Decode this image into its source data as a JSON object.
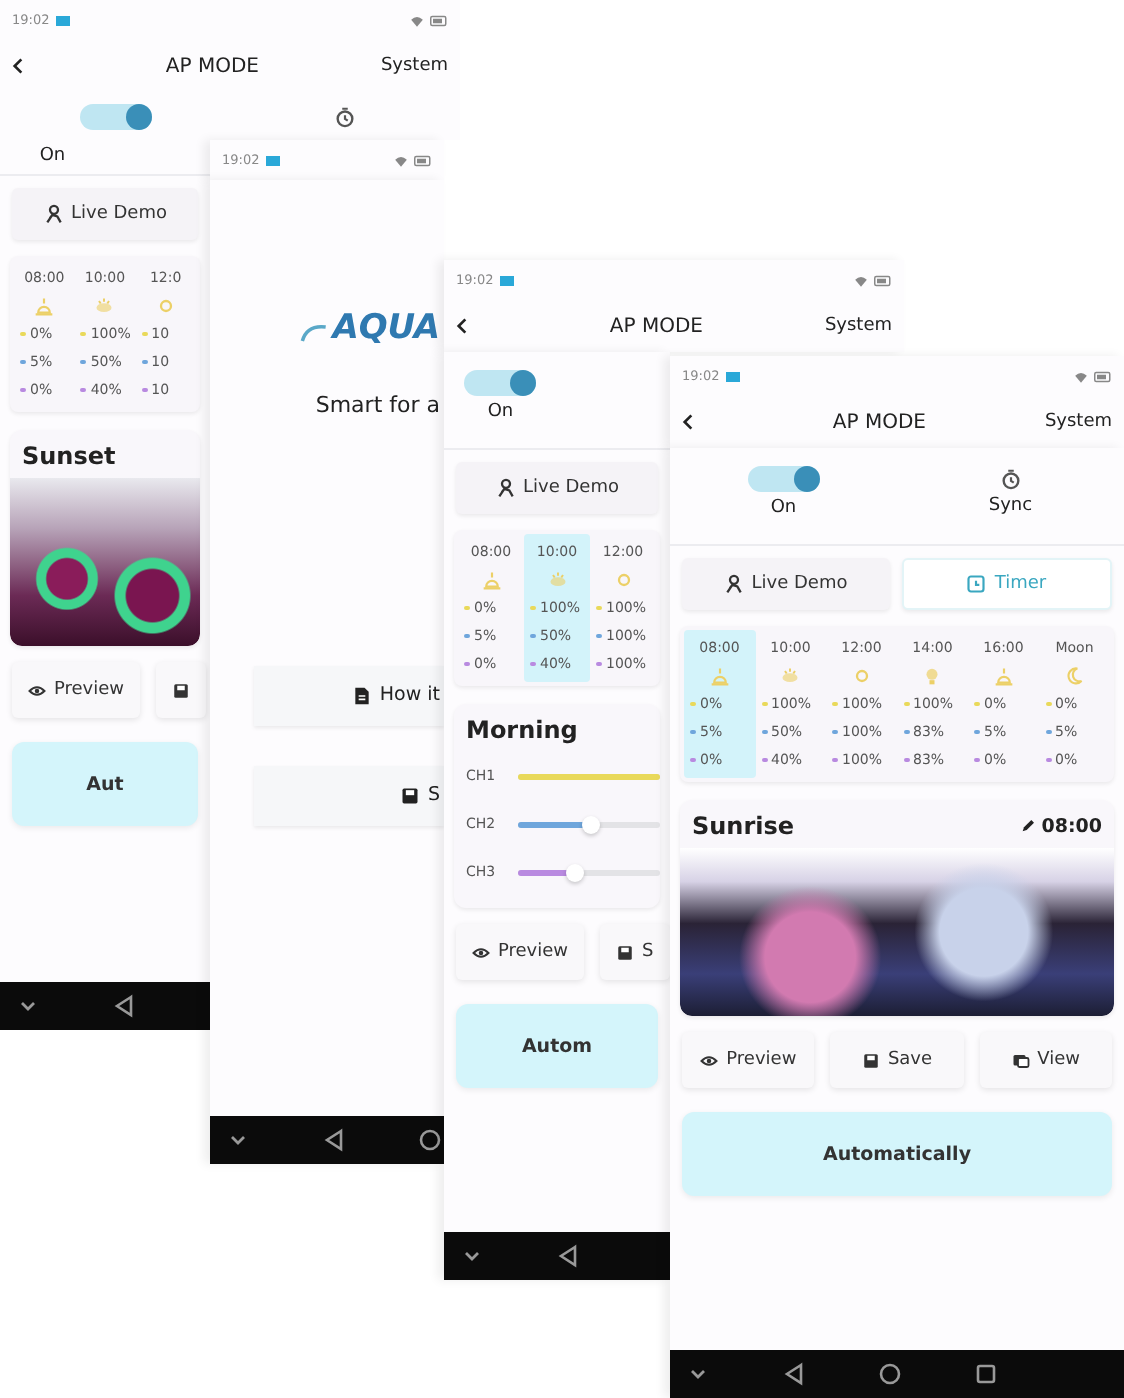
{
  "screens": [
    {
      "status_time": "19:02",
      "header": {
        "title": "AP MODE",
        "action": "System"
      },
      "toggle": {
        "on": true,
        "label": "On"
      },
      "tabs": [
        {
          "label": "Live Demo",
          "kind": "person",
          "selected": false
        }
      ],
      "timeline": {
        "columns": [
          {
            "time": "08:00",
            "kind": "sunrise",
            "selected": false,
            "values": [
              "0%",
              "5%",
              "0%"
            ]
          },
          {
            "time": "10:00",
            "kind": "cloud-sun",
            "selected": false,
            "values": [
              "100%",
              "50%",
              "40%"
            ]
          },
          {
            "time": "12:0",
            "kind": "sun",
            "selected": false,
            "values": [
              "10",
              "10",
              "10"
            ]
          }
        ]
      },
      "scene": {
        "title": "Sunset",
        "kind": "coral"
      },
      "actions": [
        {
          "kind": "eye",
          "label": "Preview"
        },
        {
          "kind": "save"
        }
      ],
      "auto_button": "Aut"
    },
    {
      "status_time": "19:02",
      "logo": "AQUA",
      "tagline": "Smart for a",
      "doc_buttons": [
        {
          "kind": "doc",
          "label": "How it"
        },
        {
          "kind": "save",
          "label": "S"
        }
      ]
    },
    {
      "status_time": "19:02",
      "header": {
        "title": "AP MODE",
        "action": "System"
      },
      "toggle": {
        "on": true,
        "label": "On"
      },
      "tabs": [
        {
          "label": "Live Demo",
          "kind": "person",
          "selected": false
        }
      ],
      "timeline": {
        "columns": [
          {
            "time": "08:00",
            "kind": "sunrise",
            "selected": false,
            "values": [
              "0%",
              "5%",
              "0%"
            ]
          },
          {
            "time": "10:00",
            "kind": "cloud-sun",
            "selected": true,
            "values": [
              "100%",
              "50%",
              "40%"
            ]
          },
          {
            "time": "12:00",
            "kind": "sun",
            "selected": false,
            "values": [
              "100%",
              "100%",
              "100%"
            ]
          }
        ]
      },
      "scene": {
        "title": "Morning",
        "channels": [
          {
            "name": "CH1",
            "level": 1
          },
          {
            "name": "CH2",
            "level": 0.5
          },
          {
            "name": "CH3",
            "level": 0.4
          }
        ]
      },
      "actions": [
        {
          "kind": "eye",
          "label": "Preview"
        },
        {
          "kind": "save",
          "label": "S"
        }
      ],
      "auto_button": "Autom"
    },
    {
      "status_time": "19:02",
      "header": {
        "title": "AP MODE",
        "action": "System"
      },
      "toggle": {
        "on": true,
        "label": "On"
      },
      "sync": {
        "label": "Sync"
      },
      "tabs": [
        {
          "label": "Live Demo",
          "kind": "person",
          "selected": false
        },
        {
          "label": "Timer",
          "kind": "timer",
          "selected": true
        }
      ],
      "timeline": {
        "columns": [
          {
            "time": "08:00",
            "kind": "sunrise",
            "selected": true,
            "values": [
              "0%",
              "5%",
              "0%"
            ]
          },
          {
            "time": "10:00",
            "kind": "cloud-sun",
            "selected": false,
            "values": [
              "100%",
              "50%",
              "40%"
            ]
          },
          {
            "time": "12:00",
            "kind": "sun",
            "selected": false,
            "values": [
              "100%",
              "100%",
              "100%"
            ]
          },
          {
            "time": "14:00",
            "kind": "bulb",
            "selected": false,
            "values": [
              "100%",
              "83%",
              "83%"
            ]
          },
          {
            "time": "16:00",
            "kind": "sunrise",
            "selected": false,
            "values": [
              "0%",
              "5%",
              "0%"
            ]
          },
          {
            "time": "Moon",
            "kind": "moon",
            "selected": false,
            "values": [
              "0%",
              "5%",
              "0%"
            ]
          }
        ]
      },
      "scene": {
        "title": "Sunrise",
        "time": "08:00",
        "kind": "reef"
      },
      "actions": [
        {
          "kind": "eye",
          "label": "Preview"
        },
        {
          "kind": "save",
          "label": "Save"
        },
        {
          "kind": "view",
          "label": "View"
        }
      ],
      "auto_button": "Automatically"
    }
  ]
}
